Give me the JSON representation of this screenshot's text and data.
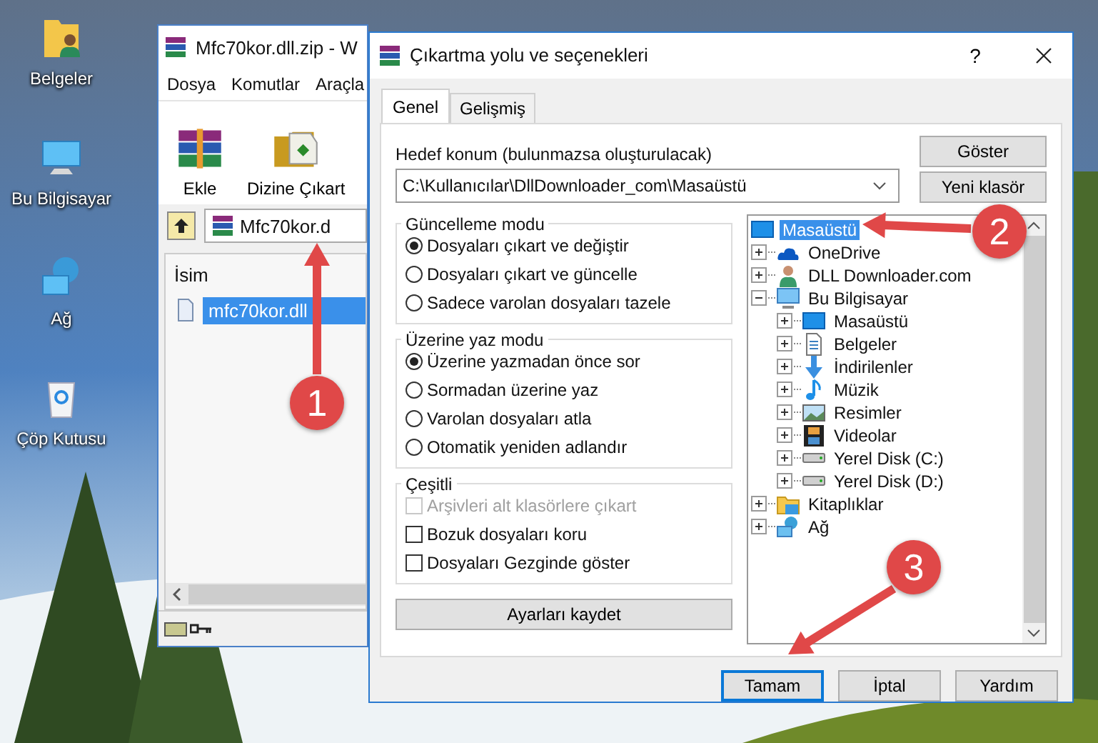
{
  "desktop_icons": [
    {
      "label": "Belgeler",
      "kind": "documents"
    },
    {
      "label": "Bu Bilgisayar",
      "kind": "computer"
    },
    {
      "label": "Ağ",
      "kind": "network"
    },
    {
      "label": "Çöp Kutusu",
      "kind": "recycle"
    }
  ],
  "archive_window": {
    "title": "Mfc70kor.dll.zip - W",
    "menu": [
      "Dosya",
      "Komutlar",
      "Araçla"
    ],
    "toolbar": [
      {
        "label": "Ekle",
        "kind": "add"
      },
      {
        "label": "Dizine Çıkart",
        "kind": "extract"
      }
    ],
    "path": "Mfc70kor.d",
    "column": "İsim",
    "files": [
      {
        "name": "mfc70kor.dll",
        "selected": true
      }
    ]
  },
  "dialog": {
    "title": "Çıkartma yolu ve seçenekleri",
    "help": "?",
    "tabs": [
      {
        "label": "Genel",
        "selected": true
      },
      {
        "label": "Gelişmiş",
        "selected": false
      }
    ],
    "destination_label": "Hedef konum (bulunmazsa oluşturulacak)",
    "destination_path": "C:\\Kullanıcılar\\DllDownloader_com\\Masaüstü",
    "side_buttons": [
      "Göster",
      "Yeni klasör"
    ],
    "groups": [
      {
        "title": "Güncelleme modu",
        "kind": "radio",
        "options": [
          {
            "label": "Dosyaları çıkart ve değiştir",
            "selected": true
          },
          {
            "label": "Dosyaları çıkart ve güncelle",
            "selected": false
          },
          {
            "label": "Sadece varolan dosyaları tazele",
            "selected": false
          }
        ]
      },
      {
        "title": "Üzerine yaz modu",
        "kind": "radio",
        "options": [
          {
            "label": "Üzerine yazmadan önce sor",
            "selected": true
          },
          {
            "label": "Sormadan üzerine yaz",
            "selected": false
          },
          {
            "label": "Varolan dosyaları atla",
            "selected": false
          },
          {
            "label": "Otomatik yeniden adlandır",
            "selected": false
          }
        ]
      },
      {
        "title": "Çeşitli",
        "kind": "checkbox",
        "options": [
          {
            "label": "Arşivleri alt klasörlere çıkart",
            "checked": false,
            "disabled": true
          },
          {
            "label": "Bozuk dosyaları koru",
            "checked": false,
            "disabled": false
          },
          {
            "label": "Dosyaları Gezginde göster",
            "checked": false,
            "disabled": false
          }
        ]
      }
    ],
    "save_button": "Ayarları kaydet",
    "folder_tree": [
      {
        "label": "Masaüstü",
        "kind": "desktop",
        "selected": true,
        "children": [
          {
            "label": "OneDrive",
            "kind": "cloud",
            "selected": false,
            "expanded": false
          },
          {
            "label": "DLL Downloader.com",
            "kind": "user",
            "selected": false,
            "expanded": false
          },
          {
            "label": "Bu Bilgisayar",
            "kind": "computer",
            "selected": false,
            "expanded": true,
            "children": [
              {
                "label": "Masaüstü",
                "kind": "desktop",
                "selected": false,
                "expanded": false
              },
              {
                "label": "Belgeler",
                "kind": "document",
                "selected": false,
                "expanded": false
              },
              {
                "label": "İndirilenler",
                "kind": "download",
                "selected": false,
                "expanded": false
              },
              {
                "label": "Müzik",
                "kind": "music",
                "selected": false,
                "expanded": false
              },
              {
                "label": "Resimler",
                "kind": "picture",
                "selected": false,
                "expanded": false
              },
              {
                "label": "Videolar",
                "kind": "video",
                "selected": false,
                "expanded": false
              },
              {
                "label": "Yerel Disk (C:)",
                "kind": "disk",
                "selected": false,
                "expanded": false
              },
              {
                "label": "Yerel Disk (D:)",
                "kind": "disk",
                "selected": false,
                "expanded": false
              }
            ]
          },
          {
            "label": "Kitaplıklar",
            "kind": "library",
            "selected": false,
            "expanded": false
          },
          {
            "label": "Ağ",
            "kind": "network",
            "selected": false,
            "expanded": false
          }
        ]
      }
    ],
    "buttons": [
      {
        "label": "Tamam",
        "default": true
      },
      {
        "label": "İptal",
        "default": false
      },
      {
        "label": "Yardım",
        "default": false
      }
    ]
  },
  "annotations": [
    {
      "number": "1"
    },
    {
      "number": "2"
    },
    {
      "number": "3"
    }
  ]
}
